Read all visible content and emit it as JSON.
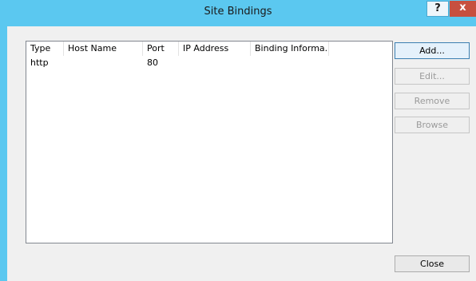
{
  "window": {
    "title": "Site Bindings",
    "help_label": "?",
    "close_label": "x"
  },
  "table": {
    "columns": [
      "Type",
      "Host Name",
      "Port",
      "IP Address",
      "Binding Informa..."
    ],
    "rows": [
      {
        "type": "http",
        "host_name": "",
        "port": "80",
        "ip_address": "",
        "binding_info": ""
      }
    ]
  },
  "buttons": {
    "add": "Add...",
    "edit": "Edit...",
    "remove": "Remove",
    "browse": "Browse",
    "close": "Close"
  },
  "colors": {
    "titlebar": "#5bc8f0",
    "close_button": "#c7503f",
    "dialog_bg": "#f0f0f0"
  }
}
